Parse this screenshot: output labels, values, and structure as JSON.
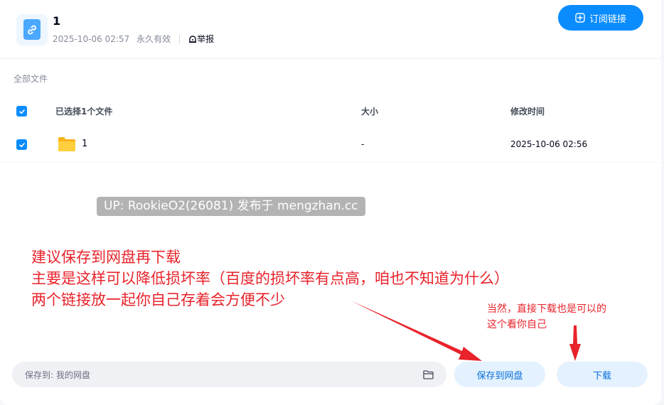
{
  "header": {
    "title": "1",
    "date": "2025-10-06 02:57",
    "validity": "永久有效",
    "report_label": "举报",
    "subscribe_label": "订阅链接"
  },
  "breadcrumb": "全部文件",
  "table": {
    "columns": [
      "已选择1个文件",
      "大小",
      "修改时间"
    ],
    "rows": [
      {
        "name": "1",
        "size": "-",
        "modified": "2025-10-06 02:56",
        "checked": true
      }
    ]
  },
  "watermark": "UP: RookieO2(26081) 发布于 mengzhan.cc",
  "annotations": {
    "main": [
      "建议保存到网盘再下载",
      "主要是这样可以降低损坏率（百度的损坏率有点高，咱也不知道为什么）",
      "两个链接放一起你自己存着会方便不少"
    ],
    "side": [
      "当然，直接下载也是可以的",
      "这个看你自己"
    ]
  },
  "footer": {
    "save_path_label": "保存到:",
    "save_path_value": "我的网盘",
    "save_button": "保存到网盘",
    "download_button": "下载"
  },
  "colors": {
    "accent": "#0a8cff",
    "annotation_red": "#e8232b",
    "button_light": "#e4f2ff"
  },
  "icons": [
    "link-file-icon",
    "report-icon",
    "subscribe-plus-icon",
    "check-icon",
    "folder-icon"
  ]
}
